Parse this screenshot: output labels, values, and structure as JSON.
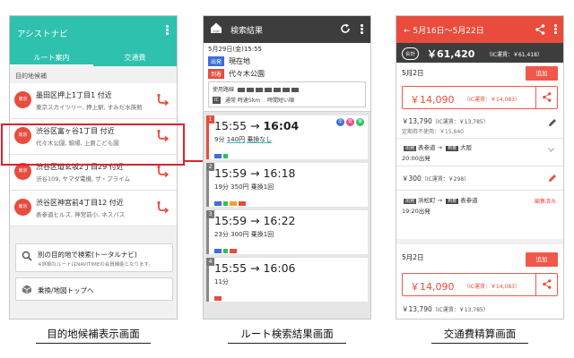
{
  "screen1": {
    "title": "アシストナビ",
    "tabs": [
      "ルート案内",
      "交通費"
    ],
    "section_label": "目的地候補",
    "pin_label": "東京",
    "items": [
      {
        "name": "墨田区押上1丁目1 付近",
        "addr": "東京スカイツリー, 押上駅, すみだ水族館"
      },
      {
        "name": "渋谷区富ヶ谷1丁目 付近",
        "addr": "代々木公園, 駒場, 上原こども園"
      },
      {
        "name": "渋谷区道玄坂2丁目29 付近",
        "addr": "渋谷109, ヤマダ電機, ザ・プライム"
      },
      {
        "name": "渋谷区神宮前4丁目12 付近",
        "addr": "表参道ヒルズ, 神宮前小, ネスパス"
      }
    ],
    "search_button": {
      "label": "別の目的地で検索(トータルナビ)",
      "note": "※詳細なルートはNAVITIMEの会員機能となります。"
    },
    "top_button": {
      "label": "乗換/地図トップへ"
    }
  },
  "screen2": {
    "title": "検索結果",
    "home_label": "TOP",
    "date": "5月29日(金)15:55",
    "dep_tag": "出発",
    "dep": "現在地",
    "arr_tag": "到着",
    "arr": "代々木公園",
    "options_label": "使用路線",
    "ic_chip": "IC",
    "walk_label": "通常 時速5km",
    "sort_label": "時間短い順",
    "badges": [
      "早",
      "安",
      "楽"
    ],
    "routes": [
      {
        "num": "1",
        "dep": "15:55",
        "arr": "16:04",
        "min": "9分",
        "fare": "140円",
        "transfer": "乗換なし"
      },
      {
        "num": "2",
        "dep": "15:59",
        "arr": "16:18",
        "min": "19分",
        "fare": "350円",
        "transfer": "乗換1回"
      },
      {
        "num": "3",
        "dep": "15:59",
        "arr": "16:22",
        "min": "23分",
        "fare": "300円",
        "transfer": "乗換1回"
      },
      {
        "num": "4",
        "dep": "15:55",
        "arr": "16:06",
        "min": "11分",
        "fare": "",
        "transfer": ""
      }
    ]
  },
  "screen3": {
    "title": "← 5月16日～5月22日",
    "total_badge": "合計",
    "total": "￥61,420",
    "total_ic": "（IC運賃：￥61,418）",
    "add_label": "追加",
    "days": [
      {
        "date": "5月2日",
        "fare": "￥14,090",
        "fare_ic": "（IC運賃：￥14,083）",
        "line1": "￥13,790",
        "line1_ic": "（IC運賃：￥13,785）",
        "line1_sub": "定期券不使用：￥15,840",
        "route1_from": "表参道",
        "route1_to": "大阪",
        "dep_tag": "出発",
        "arr_tag": "到着",
        "route1_time": "20:00出発",
        "line2": "￥300",
        "line2_ic": "（IC運賃：￥298）",
        "route2_from": "浜松町",
        "route2_to": "表参道",
        "route2_time": "19:20出発",
        "done": "編集済み"
      },
      {
        "date": "5月2日",
        "fare": "￥14,090",
        "fare_ic": "（IC運賃：￥14,083）",
        "line1": "￥13,790",
        "line1_ic": "（IC運賃：￥13,785）"
      }
    ]
  },
  "captions": [
    "目的地候補表示画面",
    "ルート検索結果画面",
    "交通費精算画面"
  ],
  "colors": {
    "teal": "#2ec1ae",
    "red": "#e94c3c",
    "dark": "#3d3d3d",
    "highlight": "#d9232d"
  }
}
